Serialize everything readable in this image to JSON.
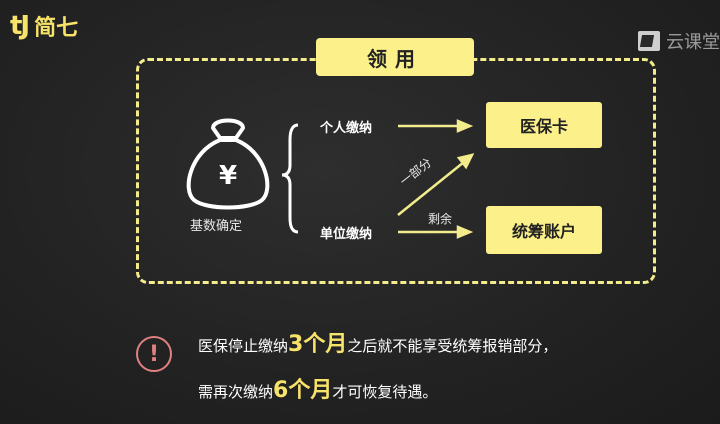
{
  "logo": {
    "mark": "tJ",
    "text": "简七"
  },
  "watermark": {
    "text": "云课堂"
  },
  "title": "领用",
  "diagram": {
    "base_label": "基数确定",
    "personal": "个人缴纳",
    "employer": "单位缴纳",
    "part": "一部分",
    "remainder": "剩余",
    "box_medical_card": "医保卡",
    "box_pool_account": "统筹账户"
  },
  "notes": {
    "line1_pre": "医保停止缴纳",
    "line1_hl": "3个月",
    "line1_post": "之后就不能享受统筹报销部分，",
    "line2_pre": "需再次缴纳",
    "line2_hl": "6个月",
    "line2_post": "才可恢复待遇。"
  },
  "colors": {
    "accent": "#fbf08a",
    "warning": "#e08080"
  }
}
